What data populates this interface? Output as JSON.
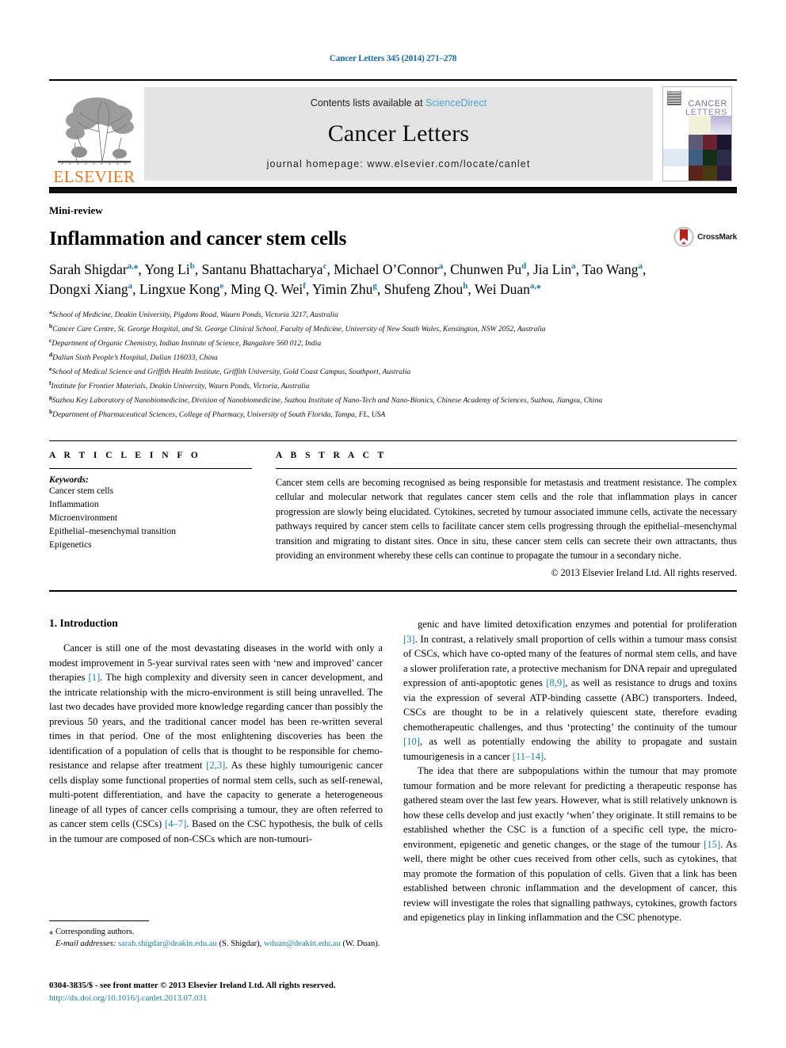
{
  "running_head": "Cancer Letters 345 (2014) 271–278",
  "masthead": {
    "publisher_logo_text": "ELSEVIER",
    "contents_prefix": "Contents lists available at ",
    "contents_link": "ScienceDirect",
    "journal_title": "Cancer Letters",
    "homepage_line": "journal homepage: www.elsevier.com/locate/canlet",
    "cover": {
      "line1": "CANCER",
      "line2": "LETTERS"
    }
  },
  "article": {
    "type_label": "Mini-review",
    "title": "Inflammation and cancer stem cells",
    "crossmark_label": "CrossMark",
    "authors": [
      {
        "name": "Sarah Shigdar",
        "sup": "a,⁎",
        "sep": ", "
      },
      {
        "name": "Yong Li",
        "sup": "b",
        "sep": ", "
      },
      {
        "name": "Santanu Bhattacharya",
        "sup": "c",
        "sep": ", "
      },
      {
        "name": "Michael O’Connor",
        "sup": "a",
        "sep": ", "
      },
      {
        "name": "Chunwen Pu",
        "sup": "d",
        "sep": ", "
      },
      {
        "name": "Jia Lin",
        "sup": "a",
        "sep": ", "
      },
      {
        "name": "Tao Wang",
        "sup": "a",
        "sep": ", "
      },
      {
        "name": "Dongxi Xiang",
        "sup": "a",
        "sep": ", "
      },
      {
        "name": "Lingxue Kong",
        "sup": "e",
        "sep": ", "
      },
      {
        "name": "Ming Q. Wei",
        "sup": "f",
        "sep": ", "
      },
      {
        "name": "Yimin Zhu",
        "sup": "g",
        "sep": ", "
      },
      {
        "name": "Shufeng Zhou",
        "sup": "h",
        "sep": ", "
      },
      {
        "name": "Wei Duan",
        "sup": "a,⁎",
        "sep": ""
      }
    ],
    "affiliations": [
      {
        "mark": "a",
        "text": "School of Medicine, Deakin University, Pigdons Road, Waurn Ponds, Victoria 3217, Australia"
      },
      {
        "mark": "b",
        "text": "Cancer Care Centre, St. George Hospital, and St. George Clinical School, Faculty of Medicine, University of New South Wales, Kensington, NSW 2052, Australia"
      },
      {
        "mark": "c",
        "text": "Department of Organic Chemistry, Indian Institute of Science, Bangalore 560 012, India"
      },
      {
        "mark": "d",
        "text": "Dalian Sixth People’s Hospital, Dalian 116033, China"
      },
      {
        "mark": "e",
        "text": "School of Medical Science and Griffith Health Institute, Griffith University, Gold Coast Campus, Southport, Australia"
      },
      {
        "mark": "f",
        "text": "Institute for Frontier Materials, Deakin University, Waurn Ponds, Victoria, Australia"
      },
      {
        "mark": "g",
        "text": "Suzhou Key Laboratory of Nanobiomedicine, Division of Nanobiomedicine, Suzhou Institute of Nano-Tech and Nano-Bionics, Chinese Academy of Sciences, Suzhou, Jiangsu, China"
      },
      {
        "mark": "h",
        "text": "Department of Pharmaceutical Sciences, College of Pharmacy, University of South Florida, Tampa, FL, USA"
      }
    ]
  },
  "article_info": {
    "heading": "A R T I C L E   I N F O",
    "keywords_label": "Keywords:",
    "keywords": [
      "Cancer stem cells",
      "Inflammation",
      "Microenvironment",
      "Epithelial–mesenchymal transition",
      "Epigenetics"
    ]
  },
  "abstract": {
    "heading": "A B S T R A C T",
    "text": "Cancer stem cells are becoming recognised as being responsible for metastasis and treatment resistance. The complex cellular and molecular network that regulates cancer stem cells and the role that inflammation plays in cancer progression are slowly being elucidated. Cytokines, secreted by tumour associated immune cells, activate the necessary pathways required by cancer stem cells to facilitate cancer stem cells progressing through the epithelial–mesenchymal transition and migrating to distant sites. Once in situ, these cancer stem cells can secrete their own attractants, thus providing an environment whereby these cells can continue to propagate the tumour in a secondary niche.",
    "copyright": "© 2013 Elsevier Ireland Ltd. All rights reserved."
  },
  "body": {
    "section_heading": "1. Introduction",
    "left_paragraphs": [
      "Cancer is still one of the most devastating diseases in the world with only a modest improvement in 5-year survival rates seen with ‘new and improved’ cancer therapies [1]. The high complexity and diversity seen in cancer development, and the intricate relationship with the micro-environment is still being unravelled. The last two decades have provided more knowledge regarding cancer than possibly the previous 50 years, and the traditional cancer model has been re-written several times in that period. One of the most enlightening discoveries has been the identification of a population of cells that is thought to be responsible for chemo-resistance and relapse after treatment [2,3]. As these highly tumourigenic cancer cells display some functional properties of normal stem cells, such as self-renewal, multi-potent differentiation, and have the capacity to generate a heterogeneous lineage of all types of cancer cells comprising a tumour, they are often referred to as cancer stem cells (CSCs) [4–7]. Based on the CSC hypothesis, the bulk of cells in the tumour are composed of non-CSCs which are non-tumouri-"
    ],
    "right_paragraphs": [
      "genic and have limited detoxification enzymes and potential for proliferation [3]. In contrast, a relatively small proportion of cells within a tumour mass consist of CSCs, which have co-opted many of the features of normal stem cells, and have a slower proliferation rate, a protective mechanism for DNA repair and upregulated expression of anti-apoptotic genes [8,9], as well as resistance to drugs and toxins via the expression of several ATP-binding cassette (ABC) transporters. Indeed, CSCs are thought to be in a relatively quiescent state, therefore evading chemotherapeutic challenges, and thus ‘protecting’ the continuity of the tumour [10], as well as potentially endowing the ability to propagate and sustain tumourigenesis in a cancer [11–14].",
      "The idea that there are subpopulations within the tumour that may promote tumour formation and be more relevant for predicting a therapeutic response has gathered steam over the last few years. However, what is still relatively unknown is how these cells develop and just exactly ‘when’ they originate. It still remains to be established whether the CSC is a function of a specific cell type, the micro-environment, epigenetic and genetic changes, or the stage of the tumour [15]. As well, there might be other cues received from other cells, such as cytokines, that may promote the formation of this population of cells. Given that a link has been established between chronic inflammation and the development of cancer, this review will investigate the roles that signalling pathways, cytokines, growth factors and epigenetics play in linking inflammation and the CSC phenotype."
    ]
  },
  "footnotes": {
    "corresponding": "⁎  Corresponding authors.",
    "email_label": "E-mail addresses:",
    "email1": "sarah.shigdar@deakin.edu.au",
    "email1_owner": "(S. Shigdar),",
    "email2": "wduan@deakin.edu.au",
    "email2_owner": "(W. Duan).",
    "issn_line": "0304-3835/$ - see front matter © 2013 Elsevier Ireland Ltd. All rights reserved.",
    "doi": "http://dx.doi.org/10.1016/j.canlet.2013.07.031"
  },
  "colors": {
    "link": "#1a7fa8",
    "sciencedirect": "#4d9fd0",
    "elsevier_orange": "#E87722",
    "masthead_bg": "#e4e4e4"
  }
}
